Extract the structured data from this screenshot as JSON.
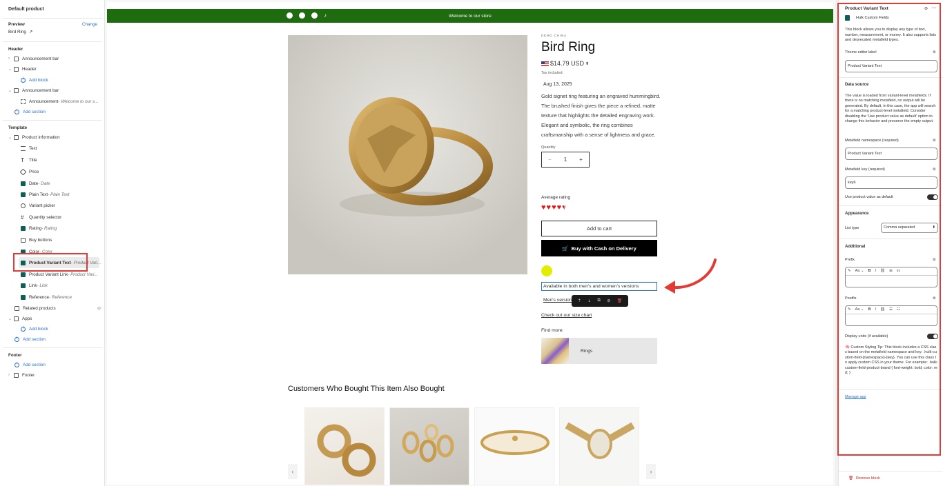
{
  "left": {
    "title": "Default product",
    "preview_label": "Preview",
    "change_label": "Change",
    "preview_value": "Bird Ring",
    "header_section": "Header",
    "announcement_bar_1": "Announcement bar",
    "header_item": "Header",
    "add_block_1": "Add block",
    "announcement_bar_2": "Announcement bar",
    "announcement_name": "Announcement",
    "announcement_sub": " - Welcome to our s...",
    "add_section_1": "Add section",
    "template_section": "Template",
    "product_information": "Product information",
    "blocks": [
      {
        "label": "Text",
        "sub": ""
      },
      {
        "label": "Title",
        "sub": ""
      },
      {
        "label": "Price",
        "sub": ""
      },
      {
        "label": "Date",
        "sub": " - Date"
      },
      {
        "label": "Plain Text",
        "sub": " - Plain Text"
      },
      {
        "label": "Variant picker",
        "sub": ""
      },
      {
        "label": "Quantity selector",
        "sub": ""
      },
      {
        "label": "Rating",
        "sub": " - Rating"
      },
      {
        "label": "Buy buttons",
        "sub": ""
      },
      {
        "label": "Color",
        "sub": " - Color"
      },
      {
        "label": "Product Variant Text",
        "sub": " - Product Vari..."
      },
      {
        "label": "Product Variant Link",
        "sub": " - Product Vari..."
      },
      {
        "label": "Link",
        "sub": " - Link"
      },
      {
        "label": "Reference",
        "sub": " - Reference"
      }
    ],
    "related_products": "Related products",
    "apps": "Apps",
    "add_block_2": "Add block",
    "add_section_2": "Add section",
    "footer_section": "Footer",
    "add_section_3": "Add section",
    "footer_item": "Footer"
  },
  "store": {
    "announcement": "Welcome to our store",
    "vendor": "DEMO CHINA",
    "title": "Bird Ring",
    "price": "$14.79 USD",
    "tax": "Tax included.",
    "date": "Aug 13, 2025",
    "description": "Gold signet ring featuring an engraved hummingbird. The brushed finish gives the piece a refined, matte texture that highlights the detailed engraving work. Elegant and symbolic, the ring combines craftsmanship with a sense of lightness and grace.",
    "quantity_label": "Quantity",
    "quantity_value": "1",
    "quantity_minus": "−",
    "quantity_plus": "+",
    "rating_label": "Average rating",
    "rating_value": 4.5,
    "rating_max": 5,
    "add_to_cart": "Add to cart",
    "buy_cod": "Buy with Cash on Delivery",
    "swatch_color": "#e4ec00",
    "variant_text": "Available in both men's and women's versions",
    "variant_link": "Men's version",
    "size_chart": "Check out our size chart",
    "find_more": "Find more:",
    "collection_name": "Rings",
    "related_heading": "Customers Who Bought This Item Also Bought",
    "prev": "‹",
    "next": "›"
  },
  "right": {
    "title": "Product Variant Text",
    "app_name": "Hulk Custom Fields",
    "description": "This block allows you to display any type of text, number, measurement, or money. It also supports lists and deprecated metafield types.",
    "theme_label_label": "Theme editor label",
    "theme_label_value": "Product Variant Text",
    "data_source": "Data source",
    "data_source_desc": "The value is loaded from variant-level metafields. If there is no matching metafield, no output will be generated. By default, in this case, the app will search for a matching product-level metafield. Consider disabling the 'Use product value as default' option to change this behavior and preserve the empty output.",
    "namespace_label": "Metafield namespace (required)",
    "namespace_value": "Product Variant Text",
    "key_label": "Metafield key (required)",
    "key_value": "key6",
    "use_default_label": "Use product value as default",
    "appearance": "Appearance",
    "list_type_label": "List type",
    "list_type_value": "Comma separated",
    "additional": "Additional",
    "prefix_label": "Prefix",
    "postfix_label": "Postfix",
    "display_units_label": "Display units (if available)",
    "tip": "🧠 Custom Styling Tip: This block includes a CSS class based on the metafield namespace and key: .hulk-custom-field-{namespace}-{key}. You can use this class to apply custom CSS in your theme. For example: .hulk-custom-field-product-brand { font-weight: bold; color: red; }",
    "manage_app": "Manage app",
    "remove_block": "Remove block"
  },
  "colors": {
    "announcement_bg": "#1f6b10",
    "highlight": "#e53935",
    "link_blue": "#2c6ecb",
    "app_teal": "#0f5f59"
  }
}
